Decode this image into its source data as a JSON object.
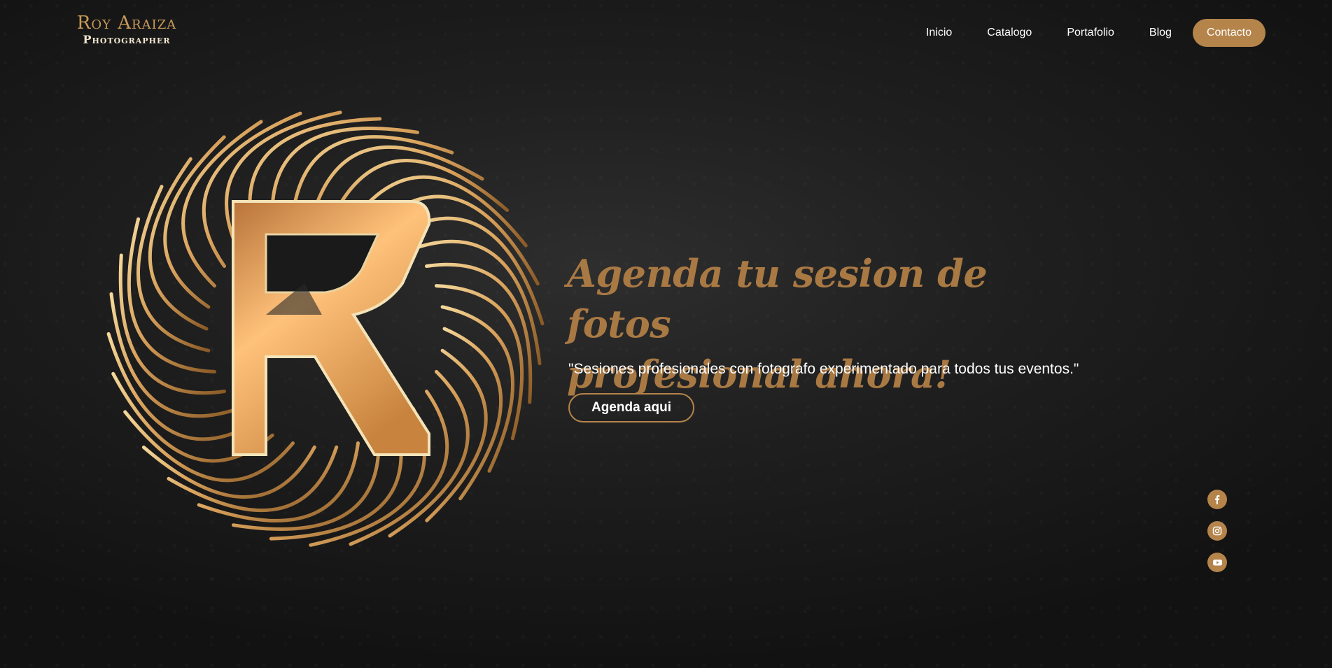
{
  "brand": {
    "name": "Roy Araiza",
    "subtitle": "Photographer"
  },
  "nav": {
    "items": [
      {
        "label": "Inicio"
      },
      {
        "label": "Catalogo"
      },
      {
        "label": "Portafolio"
      },
      {
        "label": "Blog"
      }
    ],
    "cta_label": "Contacto"
  },
  "hero": {
    "title_line1": "Agenda tu sesion de fotos",
    "title_line2": "profesional ahora!",
    "subtitle": "\"Sesiones profesionales con fotografo experimentado para todos tus eventos.\"",
    "button_label": "Agenda aqui"
  },
  "social": [
    {
      "icon": "facebook-icon"
    },
    {
      "icon": "instagram-icon"
    },
    {
      "icon": "youtube-icon"
    }
  ],
  "colors": {
    "accent": "#b5844b",
    "title": "#a97944",
    "background": "#1c1c1c",
    "text": "#ffffff"
  }
}
